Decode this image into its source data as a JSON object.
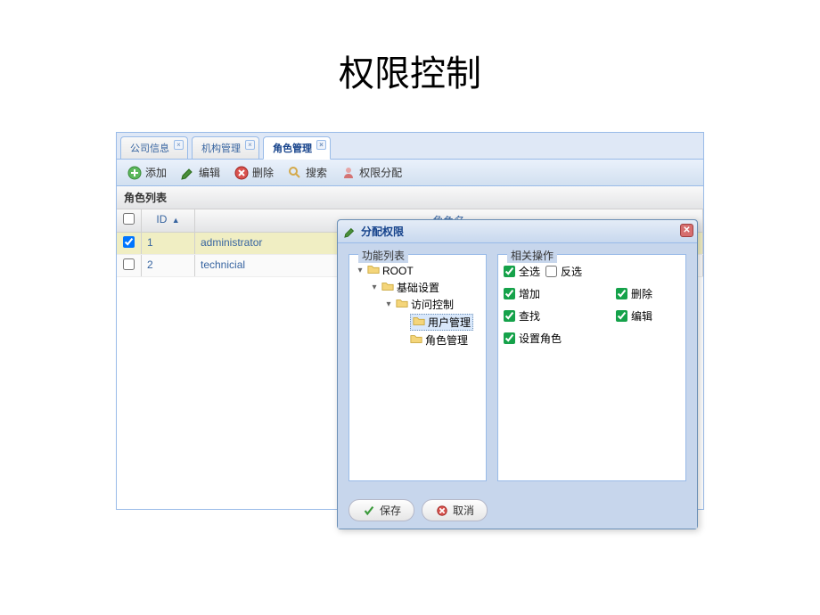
{
  "page": {
    "title": "权限控制"
  },
  "tabs": [
    {
      "label": "公司信息",
      "active": false
    },
    {
      "label": "机构管理",
      "active": false
    },
    {
      "label": "角色管理",
      "active": true
    }
  ],
  "toolbar": {
    "add": "添加",
    "edit": "编辑",
    "delete": "删除",
    "search": "搜索",
    "assign": "权限分配"
  },
  "list": {
    "title": "角色列表",
    "columns": {
      "id": "ID",
      "name": "角色名"
    },
    "rows": [
      {
        "id": "1",
        "name": "administrator",
        "checked": true,
        "selected": true
      },
      {
        "id": "2",
        "name": "technicial",
        "checked": false,
        "selected": false
      }
    ]
  },
  "dialog": {
    "title": "分配权限",
    "tree_legend": "功能列表",
    "ops_legend": "相关操作",
    "tree": {
      "root": "ROOT",
      "base": "基础设置",
      "access": "访问控制",
      "user_mgmt": "用户管理",
      "role_mgmt": "角色管理"
    },
    "ops": {
      "select_all": "全选",
      "invert": "反选",
      "add": "增加",
      "delete": "删除",
      "find": "查找",
      "edit": "编辑",
      "set_role": "设置角色"
    },
    "buttons": {
      "save": "保存",
      "cancel": "取消"
    }
  }
}
